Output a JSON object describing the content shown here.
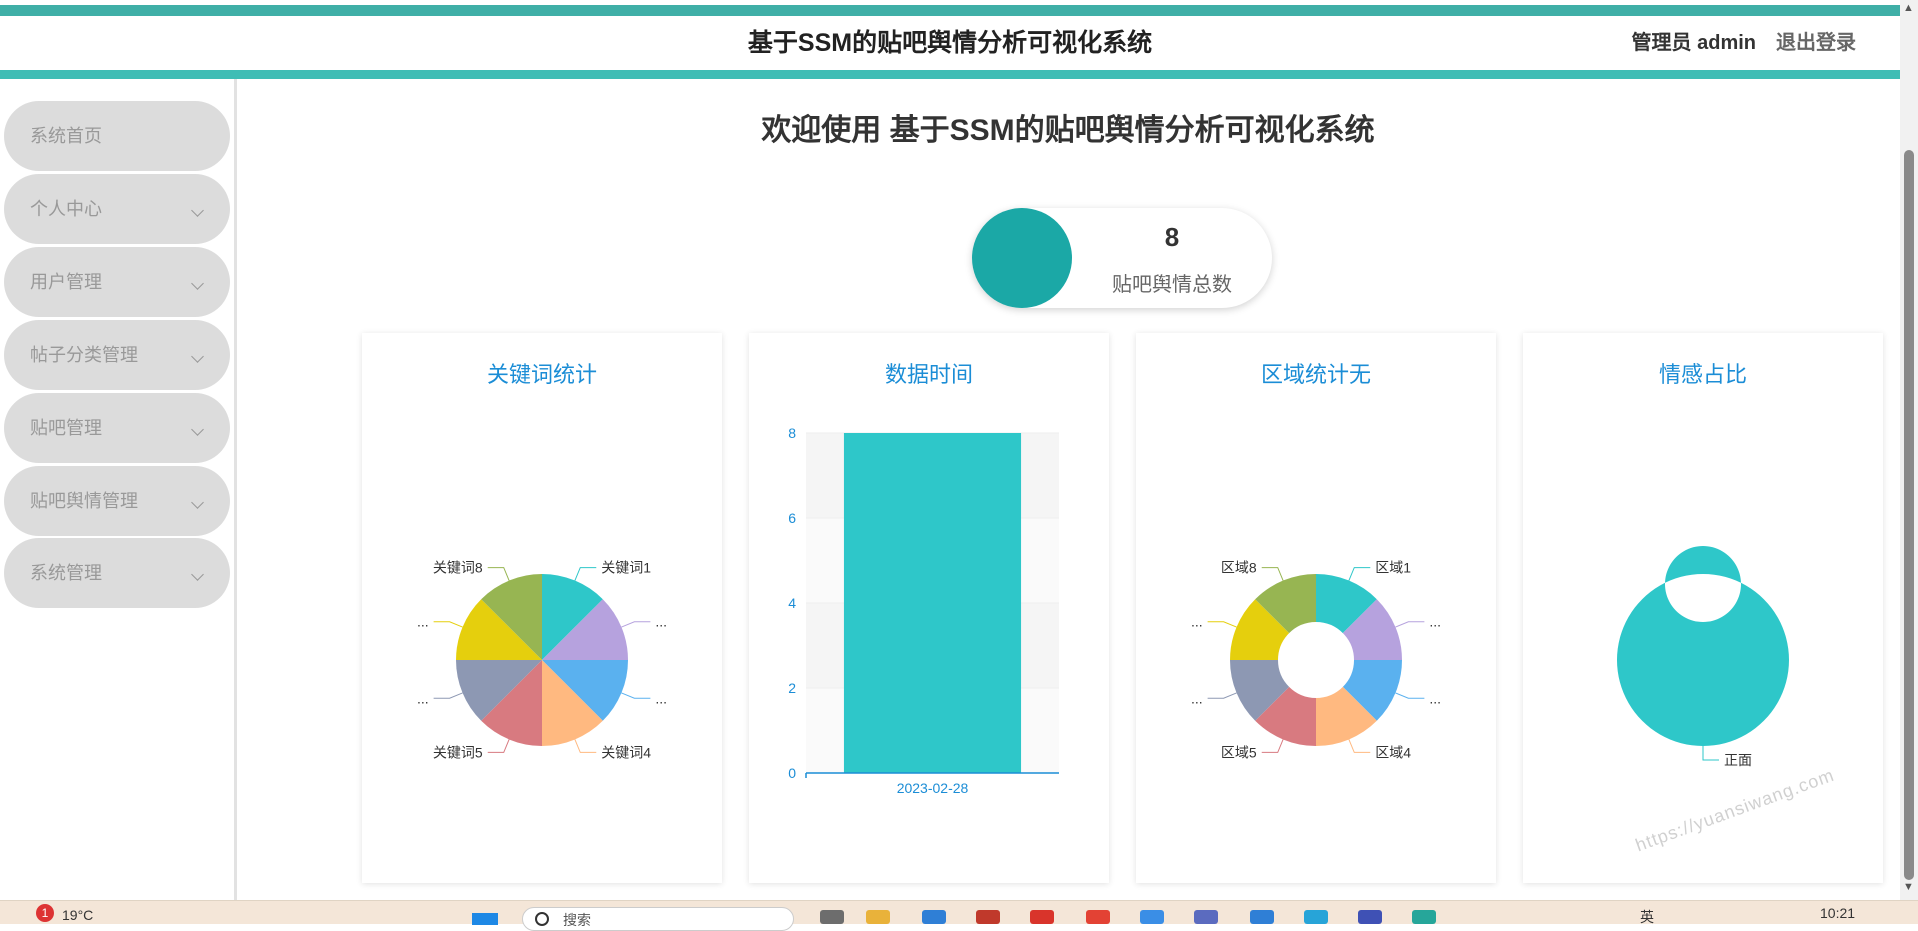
{
  "header": {
    "title": "基于SSM的贴吧舆情分析可视化系统",
    "user_label": "管理员 admin",
    "logout_label": "退出登录"
  },
  "sidebar": {
    "items": [
      {
        "label": "系统首页",
        "has_children": false
      },
      {
        "label": "个人中心",
        "has_children": true
      },
      {
        "label": "用户管理",
        "has_children": true
      },
      {
        "label": "帖子分类管理",
        "has_children": true
      },
      {
        "label": "贴吧管理",
        "has_children": true
      },
      {
        "label": "贴吧舆情管理",
        "has_children": true
      },
      {
        "label": "系统管理",
        "has_children": true
      }
    ]
  },
  "main": {
    "welcome": "欢迎使用 基于SSM的贴吧舆情分析可视化系统",
    "stat": {
      "value": "8",
      "label": "贴吧舆情总数"
    }
  },
  "chart_data": [
    {
      "type": "pie",
      "title": "关键词统计",
      "categories": [
        "关键词1",
        "...",
        "...",
        "关键词4",
        "关键词5",
        "...",
        "...",
        "关键词8"
      ],
      "values": [
        1,
        1,
        1,
        1,
        1,
        1,
        1,
        1
      ],
      "colors": [
        "#2ec7c9",
        "#b6a2de",
        "#5ab1ef",
        "#ffb980",
        "#d87a80",
        "#8d98b3",
        "#e5cf0d",
        "#97b552"
      ]
    },
    {
      "type": "bar",
      "title": "数据时间",
      "categories": [
        "2023-02-28"
      ],
      "values": [
        8
      ],
      "ylim": [
        0,
        8
      ],
      "yticks": [
        0,
        2,
        4,
        6,
        8
      ],
      "color": "#2ec7c9"
    },
    {
      "type": "pie",
      "title": "区域统计无",
      "donut": true,
      "categories": [
        "区域1",
        "...",
        "...",
        "区域4",
        "区域5",
        "...",
        "...",
        "区域8"
      ],
      "values": [
        1,
        1,
        1,
        1,
        1,
        1,
        1,
        1
      ],
      "colors": [
        "#2ec7c9",
        "#b6a2de",
        "#5ab1ef",
        "#ffb980",
        "#d87a80",
        "#8d98b3",
        "#e5cf0d",
        "#97b552"
      ]
    },
    {
      "type": "pie",
      "title": "情感占比",
      "donut": true,
      "categories": [
        "正面"
      ],
      "values": [
        8
      ],
      "colors": [
        "#2ec7c9"
      ]
    }
  ],
  "watermark": "https://yuansiwang.com",
  "taskbar": {
    "badge": "1",
    "weather": "19°C",
    "search_placeholder": "搜索",
    "lang": "英",
    "time": "10:21"
  }
}
